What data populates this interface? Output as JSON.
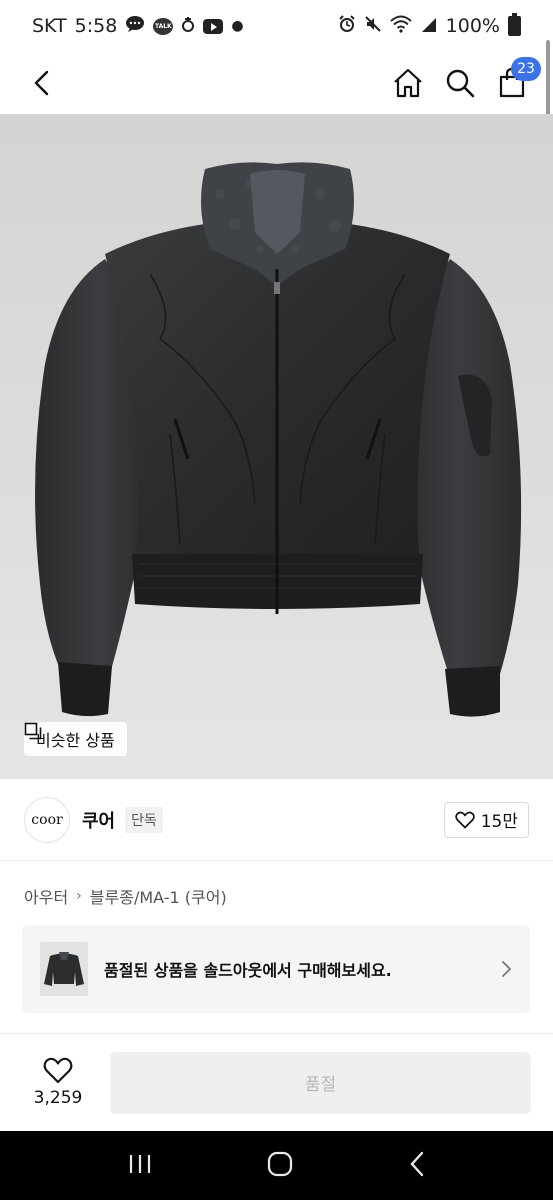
{
  "status": {
    "carrier": "SKT",
    "time": "5:58",
    "battery": "100%"
  },
  "header": {
    "cart_count": "23"
  },
  "hero": {
    "similar_label": "비슷한 상품"
  },
  "brand": {
    "logo_text": "coor",
    "name": "쿠어",
    "tag": "단독",
    "likes": "15만"
  },
  "breadcrumb": [
    "아우터",
    "블루종/MA-1 (쿠어)"
  ],
  "soldout_card": {
    "text": "품절된 상품을 솔드아웃에서 구매해보세요."
  },
  "action_bar": {
    "fav_count": "3,259",
    "button_label": "품절"
  },
  "colors": {
    "accent": "#3b73e6",
    "disabled_bg": "#efefef",
    "disabled_text": "#b7b7b7"
  },
  "icons": [
    "back-icon",
    "home-icon",
    "search-icon",
    "cart-icon",
    "similar-icon",
    "heart-icon",
    "chevron-right-icon",
    "recents-icon",
    "home-circle-icon",
    "nav-back-icon"
  ]
}
